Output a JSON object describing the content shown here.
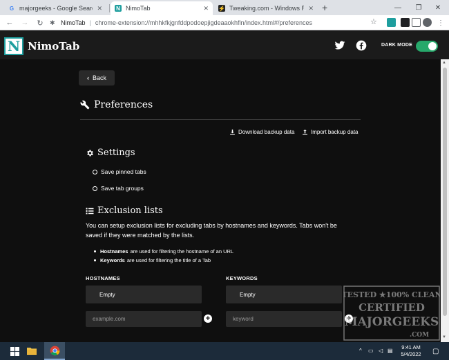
{
  "browser": {
    "tabs": [
      {
        "title": "majorgeeks - Google Search",
        "favicon": "google-icon",
        "active": false
      },
      {
        "title": "NimoTab",
        "favicon": "nimotab-icon",
        "active": true
      },
      {
        "title": "Tweaking.com - Windows Repair",
        "favicon": "tweaking-icon",
        "active": false
      }
    ],
    "new_tab_glyph": "+",
    "address": {
      "origin": "NimoTab",
      "url": "chrome-extension://mhhkfkjgnfddpodoepjigdeaaokhfln/index.html#/preferences"
    }
  },
  "app": {
    "logo_letter": "N",
    "brand": "NimoTab",
    "dark_mode_label": "DARK MODE",
    "dark_mode_on": true,
    "accent_color": "#27a96b"
  },
  "page": {
    "back_label": "Back",
    "title": "Preferences",
    "download_backup": "Download backup data",
    "import_backup": "Import backup data",
    "settings": {
      "heading": "Settings",
      "options": [
        "Save pinned tabs",
        "Save tab groups"
      ]
    },
    "exclusion": {
      "heading": "Exclusion lists",
      "description": "You can setup exclusion lists for excluding tabs by hostnames and keywords. Tabs won't be saved if they were matched by the lists.",
      "bullets": [
        {
          "term": "Hostnames",
          "text": "are used for filtering the hostname of an URL"
        },
        {
          "term": "Keywords",
          "text": "are used for filtering the title of a Tab"
        }
      ],
      "hostnames": {
        "label": "HOSTNAMES",
        "empty": "Empty",
        "placeholder": "example.com"
      },
      "keywords": {
        "label": "KEYWORDS",
        "empty": "Empty",
        "placeholder": "keyword"
      }
    }
  },
  "watermark": {
    "line1": "TESTED ★100% CLEAN",
    "line2": "CERTIFIED",
    "line3": "MAJORGEEKS",
    "line4": ".COM"
  },
  "taskbar": {
    "time": "9:41 AM",
    "date": "5/4/2022"
  }
}
